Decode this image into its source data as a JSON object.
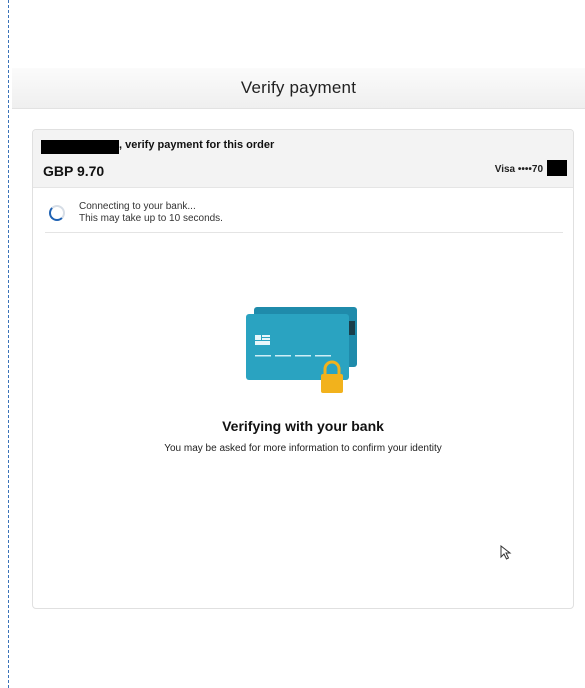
{
  "header": {
    "title": "Verify payment"
  },
  "order": {
    "verify_text": ", verify payment for this order",
    "amount": "GBP 9.70",
    "card_label": "Visa ••••70"
  },
  "status": {
    "line1": "Connecting to your bank...",
    "line2": "This may take up to 10 seconds."
  },
  "main": {
    "title": "Verifying with your bank",
    "subtitle": "You may be asked for more information to confirm your identity"
  },
  "colors": {
    "card_front": "#2aa3c1",
    "card_back": "#1f8bab",
    "lock": "#f2b21c",
    "spinner": "#1f62b3"
  },
  "icons": {
    "spinner": "loading-spinner-icon",
    "card": "credit-card-lock-icon",
    "cursor": "mouse-pointer-icon"
  }
}
